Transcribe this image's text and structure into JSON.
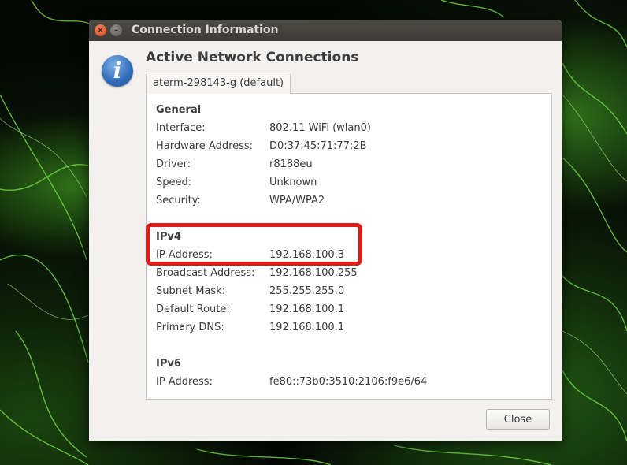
{
  "window": {
    "title": "Connection Information"
  },
  "heading": "Active Network Connections",
  "tab_label": "aterm-298143-g (default)",
  "sections": {
    "general": {
      "title": "General",
      "rows": [
        {
          "label": "Interface:",
          "value": "802.11 WiFi (wlan0)"
        },
        {
          "label": "Hardware Address:",
          "value": "D0:37:45:71:77:2B"
        },
        {
          "label": "Driver:",
          "value": "r8188eu"
        },
        {
          "label": "Speed:",
          "value": "Unknown"
        },
        {
          "label": "Security:",
          "value": "WPA/WPA2"
        }
      ]
    },
    "ipv4": {
      "title": "IPv4",
      "rows": [
        {
          "label": "IP Address:",
          "value": "192.168.100.3"
        },
        {
          "label": "Broadcast Address:",
          "value": "192.168.100.255"
        },
        {
          "label": "Subnet Mask:",
          "value": "255.255.255.0"
        },
        {
          "label": "Default Route:",
          "value": "192.168.100.1"
        },
        {
          "label": "Primary DNS:",
          "value": "192.168.100.1"
        }
      ]
    },
    "ipv6": {
      "title": "IPv6",
      "rows": [
        {
          "label": "IP Address:",
          "value": "fe80::73b0:3510:2106:f9e6/64"
        }
      ]
    }
  },
  "close_button": "Close",
  "colors": {
    "highlight": "#e01a14",
    "titlebar": "#3c3b37",
    "info_icon": "#2f6bb8"
  },
  "icons": {
    "info": "info-icon",
    "close_window": "close-icon",
    "minimize_window": "minimize-icon"
  }
}
